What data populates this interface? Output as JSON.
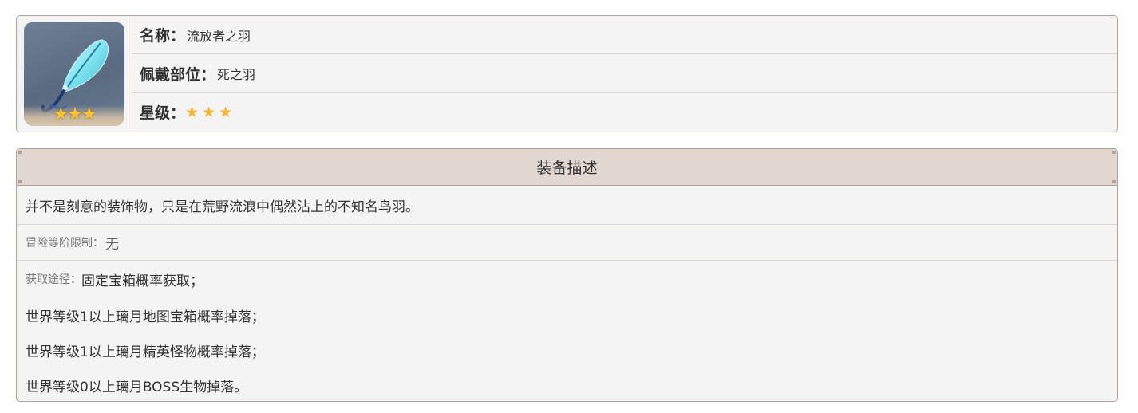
{
  "item": {
    "name_label": "名称：",
    "name": "流放者之羽",
    "slot_label": "佩戴部位：",
    "slot": "死之羽",
    "rarity_label": "星级：",
    "rarity": 3,
    "stars_glyph": "★",
    "icon": "feather-icon"
  },
  "description": {
    "header": "装备描述",
    "text": "并不是刻意的装饰物，只是在荒野流浪中偶然沾上的不知名鸟羽。",
    "limit_label": "冒险等阶限制：",
    "limit_value": "无",
    "source_label": "获取途径：",
    "sources": [
      "固定宝箱概率获取；",
      "世界等级1以上璃月地图宝箱概率掉落；",
      "世界等级1以上璃月精英怪物概率掉落；",
      "世界等级0以上璃月BOSS生物掉落。"
    ]
  },
  "colors": {
    "border": "#b5a294",
    "header_bg": "#e2d8d1",
    "star": "#f2b637",
    "card_bg": "#f4f4f4"
  }
}
